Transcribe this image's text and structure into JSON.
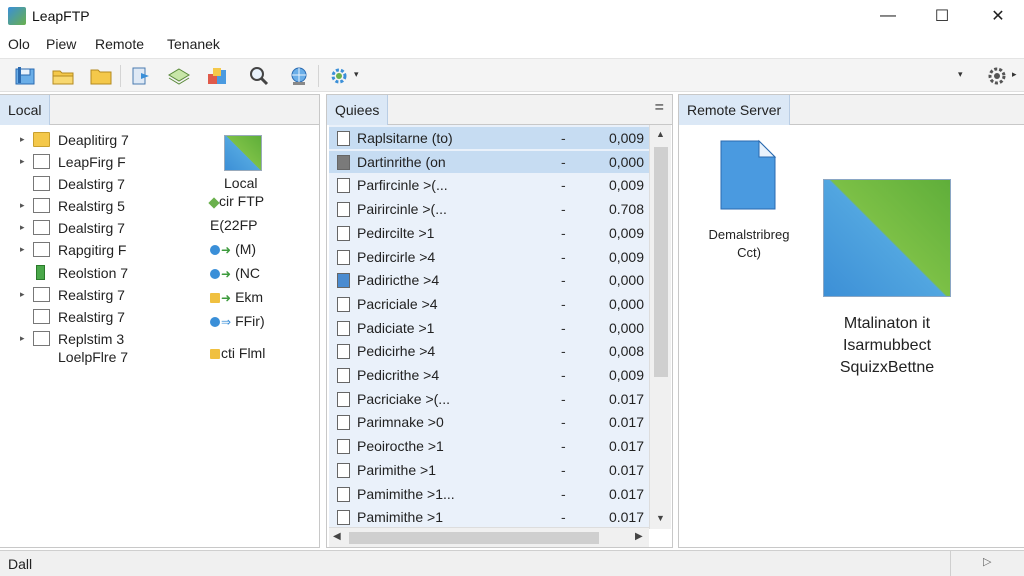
{
  "window": {
    "title": "LeapFTP",
    "minimize_glyph": "—",
    "maximize_glyph": "☐",
    "close_glyph": "✕"
  },
  "menu": [
    {
      "label": "Olo"
    },
    {
      "label": "Piew"
    },
    {
      "label": "Remote"
    },
    {
      "label": "Tenanek"
    }
  ],
  "toolbar": {
    "icons": [
      "save-icon",
      "open-folder-icon",
      "folder-icon",
      "transfer-icon",
      "layers-icon",
      "compare-icon",
      "search-icon",
      "globe-icon",
      "settings-gear-icon"
    ],
    "dropdown_glyph": "▾",
    "right_settings_icon": "gear-icon"
  },
  "local": {
    "tab_label": "Local",
    "tree": [
      {
        "label": "Deaplitirg 7",
        "arrow": true,
        "icon": "folder"
      },
      {
        "label": "LeapFirg F",
        "arrow": true,
        "icon": "doc"
      },
      {
        "label": "Dealstirg 7",
        "arrow": false,
        "icon": "doc"
      },
      {
        "label": "Realstirg 5",
        "arrow": true,
        "icon": "doc"
      },
      {
        "label": "Dealstirg 7",
        "arrow": true,
        "icon": "doc"
      },
      {
        "label": "Rapgitirg F",
        "arrow": true,
        "icon": "doc-lines"
      },
      {
        "label": "Reolstion 7",
        "arrow": false,
        "icon": "green"
      },
      {
        "label": "Realstirg 7",
        "arrow": true,
        "icon": "doc-lines"
      },
      {
        "label": "Realstirg 7",
        "arrow": false,
        "icon": "doc-lines"
      },
      {
        "label": "Replstim 3",
        "arrow": true,
        "icon": "doc-lines"
      },
      {
        "label": "LoelpFlre 7",
        "arrow": false,
        "icon": "none"
      }
    ],
    "info": {
      "title": "Local",
      "rows": [
        {
          "text": "cir FTP",
          "dot": "#6ab04c",
          "arrow": ""
        },
        {
          "text": "E(22FP",
          "dot": "",
          "arrow": ""
        },
        {
          "text": "(M)",
          "dot": "#3a8fd8",
          "arrow": "➜"
        },
        {
          "text": "(NC",
          "dot": "#3a8fd8",
          "arrow": "➜"
        },
        {
          "text": "Ekm",
          "dot": "#f0c040",
          "arrow": "➜"
        },
        {
          "text": "FFir)",
          "dot": "#3a8fd8",
          "arrow": "⇒"
        },
        {
          "text": "cti Flml",
          "dot": "#f0c040",
          "arrow": ""
        }
      ]
    }
  },
  "queue": {
    "tab_label": "Quiees",
    "menu_glyph": "=",
    "rows": [
      {
        "name": "Raplsitarne (to)",
        "dash": "-",
        "value": "0,009",
        "selected": true,
        "icon": "plain"
      },
      {
        "name": "Dartinrithe (on",
        "dash": "-",
        "value": "0,000",
        "selected": true,
        "icon": "dark"
      },
      {
        "name": "Parfircinle >(...",
        "dash": "-",
        "value": "0,009",
        "selected": false,
        "icon": "plain"
      },
      {
        "name": "Pairircinle >(...",
        "dash": "-",
        "value": "0.708",
        "selected": false,
        "icon": "plain"
      },
      {
        "name": "Pedircilte >1",
        "dash": "-",
        "value": "0,009",
        "selected": false,
        "icon": "plain"
      },
      {
        "name": "Pedircirle >4",
        "dash": "-",
        "value": "0,009",
        "selected": false,
        "icon": "plain"
      },
      {
        "name": "Padiricthe >4",
        "dash": "-",
        "value": "0,000",
        "selected": false,
        "icon": "blue"
      },
      {
        "name": "Pacriciale >4",
        "dash": "-",
        "value": "0,000",
        "selected": false,
        "icon": "plain"
      },
      {
        "name": "Padiciate >1",
        "dash": "-",
        "value": "0,000",
        "selected": false,
        "icon": "plain"
      },
      {
        "name": "Pedicirhe >4",
        "dash": "-",
        "value": "0,008",
        "selected": false,
        "icon": "plain"
      },
      {
        "name": "Pedicrithe >4",
        "dash": "-",
        "value": "0,009",
        "selected": false,
        "icon": "plain"
      },
      {
        "name": "Pacriciake >(...",
        "dash": "-",
        "value": "0.017",
        "selected": false,
        "icon": "plain"
      },
      {
        "name": "Parimnake >0",
        "dash": "-",
        "value": "0.017",
        "selected": false,
        "icon": "plain"
      },
      {
        "name": "Peoirocthe >1",
        "dash": "-",
        "value": "0.017",
        "selected": false,
        "icon": "plain"
      },
      {
        "name": "Parimithe >1",
        "dash": "-",
        "value": "0.017",
        "selected": false,
        "icon": "plain"
      },
      {
        "name": "Pamimithe >1...",
        "dash": "-",
        "value": "0.017",
        "selected": false,
        "icon": "plain"
      },
      {
        "name": "Pamimithe >1",
        "dash": "-",
        "value": "0.017",
        "selected": false,
        "icon": "plain"
      }
    ]
  },
  "remote": {
    "tab_label": "Remote Server",
    "file_label_1": "Demalstribreg",
    "file_label_2": "Cct)",
    "message_1": "Mtalinaton it",
    "message_2": "Isarmubbect",
    "message_3": "SquizxBettne"
  },
  "status": {
    "text": "Dall",
    "arrow_glyph": "▷"
  }
}
